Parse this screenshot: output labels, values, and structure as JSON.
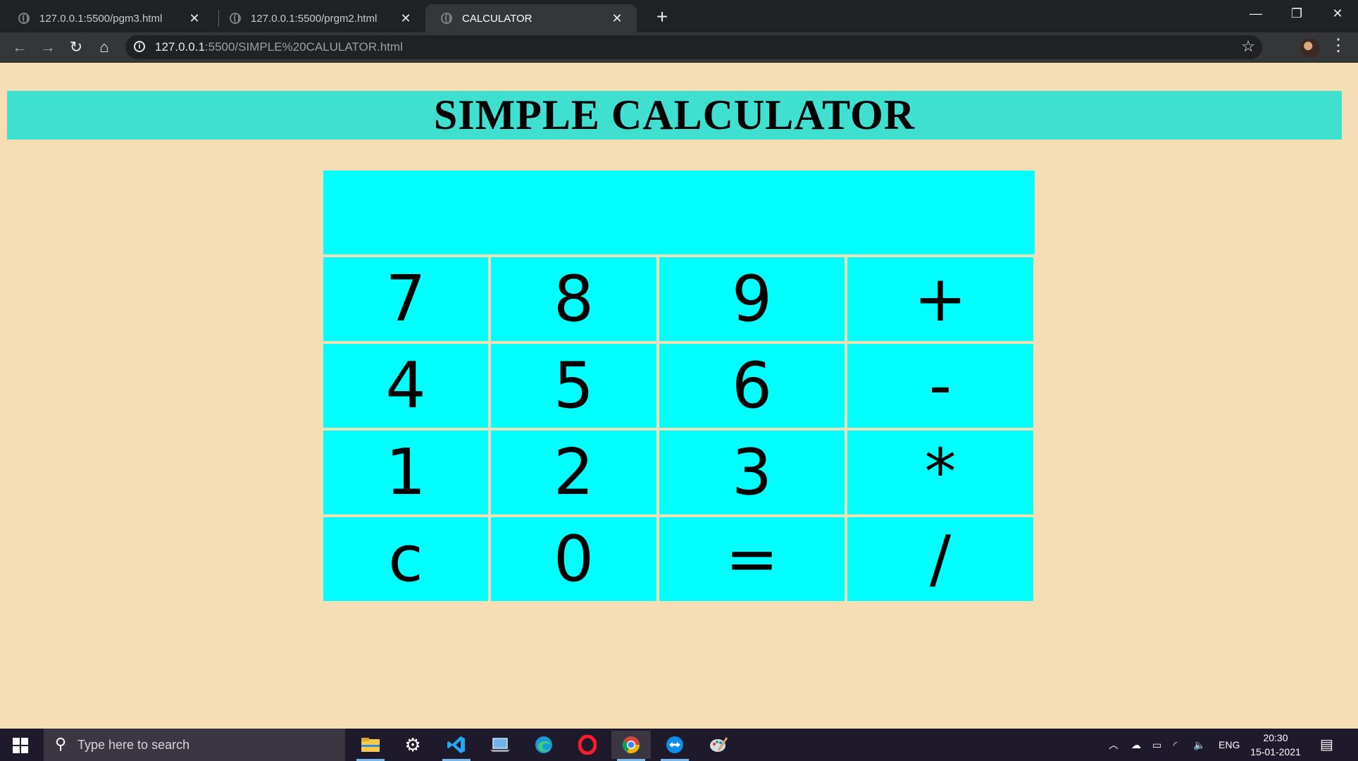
{
  "browser": {
    "tabs": [
      {
        "title": "127.0.0.1:5500/pgm3.html",
        "active": false
      },
      {
        "title": "127.0.0.1:5500/prgm2.html",
        "active": false
      },
      {
        "title": "CALCULATOR",
        "active": true
      }
    ],
    "close_glyph": "✕",
    "new_tab_glyph": "+",
    "url_host": "127.0.0.1",
    "url_rest": ":5500/SIMPLE%20CALULATOR.html"
  },
  "page": {
    "title": "SIMPLE CALCULATOR",
    "display_value": "",
    "keys": [
      [
        "7",
        "8",
        "9",
        "+"
      ],
      [
        "4",
        "5",
        "6",
        "-"
      ],
      [
        "1",
        "2",
        "3",
        "*"
      ],
      [
        "c",
        "0",
        "=",
        "/"
      ]
    ],
    "colors": {
      "background": "#f5deb3",
      "header": "#40e0d0",
      "keys": "#00ffff"
    }
  },
  "taskbar": {
    "search_placeholder": "Type here to search",
    "icons": [
      "file-explorer-icon",
      "settings-icon",
      "vscode-icon",
      "laptop-icon",
      "edge-icon",
      "opera-icon",
      "chrome-icon",
      "teamviewer-icon",
      "paint-icon"
    ],
    "language": "ENG",
    "time": "20:30",
    "date": "15-01-2021"
  }
}
